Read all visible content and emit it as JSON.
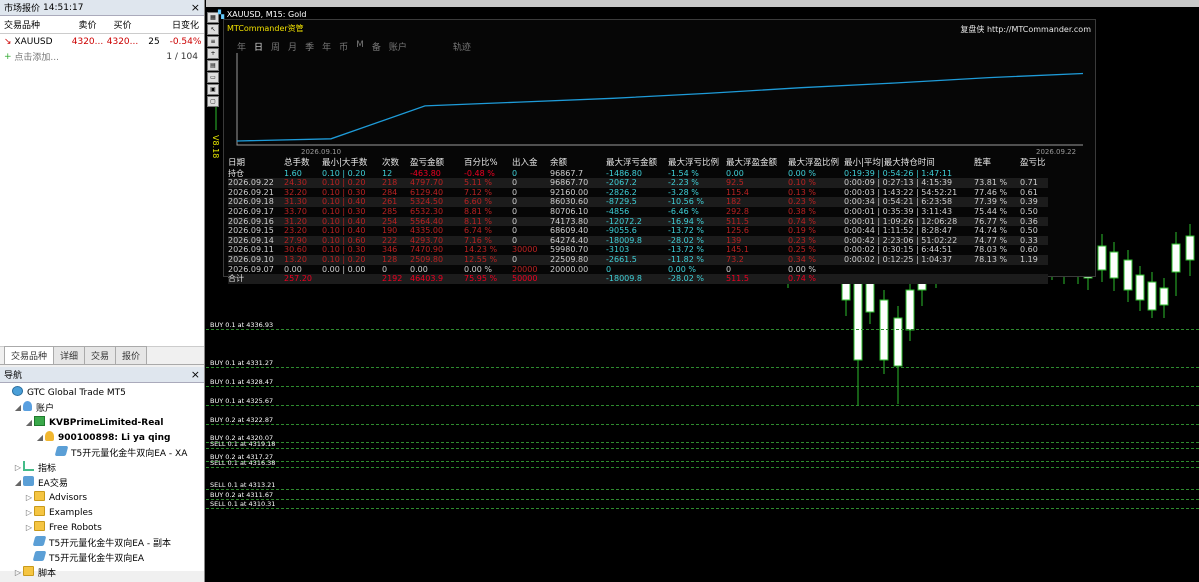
{
  "market_watch": {
    "title": "市场报价",
    "time": "14:51:17",
    "columns": [
      "交易品种",
      "卖价",
      "买价",
      "",
      "日变化"
    ],
    "rows": [
      {
        "symbol": "XAUUSD",
        "bid": "4320...",
        "ask": "4320...",
        "spread": "25",
        "change": "-0.54%"
      }
    ],
    "add_label": "点击添加...",
    "count": "1 / 104",
    "tabs": [
      "交易品种",
      "详细",
      "交易",
      "报价"
    ]
  },
  "navigator": {
    "title": "导航",
    "items": [
      {
        "label": "GTC Global Trade MT5",
        "level": 0,
        "toggle": "",
        "icon": "globe-icon"
      },
      {
        "label": "账户",
        "level": 1,
        "toggle": "◢",
        "icon": "accounts-icon"
      },
      {
        "label": "KVBPrimeLimited-Real",
        "level": 2,
        "toggle": "◢",
        "icon": "server-icon",
        "bold": true
      },
      {
        "label": "900100898: Li ya qing",
        "level": 3,
        "toggle": "◢",
        "icon": "user-icon",
        "bold": true
      },
      {
        "label": "T5开元量化金牛双向EA - XA",
        "level": 4,
        "toggle": "",
        "icon": "ea-icon"
      },
      {
        "label": "指标",
        "level": 1,
        "toggle": "▷",
        "icon": "indicator-icon"
      },
      {
        "label": "EA交易",
        "level": 1,
        "toggle": "◢",
        "icon": "ea-folder-icon"
      },
      {
        "label": "Advisors",
        "level": 2,
        "toggle": "▷",
        "icon": "folder-icon"
      },
      {
        "label": "Examples",
        "level": 2,
        "toggle": "▷",
        "icon": "folder-icon"
      },
      {
        "label": "Free Robots",
        "level": 2,
        "toggle": "▷",
        "icon": "folder-icon"
      },
      {
        "label": "T5开元量化金牛双向EA - 副本",
        "level": 2,
        "toggle": "",
        "icon": "ea-icon"
      },
      {
        "label": "T5开元量化金牛双向EA",
        "level": 2,
        "toggle": "",
        "icon": "ea-icon"
      },
      {
        "label": "脚本",
        "level": 1,
        "toggle": "▷",
        "icon": "script-icon"
      }
    ]
  },
  "chart": {
    "title": "XAUUSD, M15:  Gold",
    "version_label": "V8.18",
    "mtc_title": "MTCommander资管",
    "mtc_site": "复盘侠 http://MTCommander.com",
    "mtc_tabs": [
      "年",
      "日",
      "周",
      "月",
      "季",
      "年",
      "币",
      "M",
      "备",
      "账户",
      "",
      "轨迹"
    ],
    "mtc_tab_selected": 1,
    "equity_start_label": "2026.09.10",
    "equity_end_label": "2026.09.22",
    "equity_curve": [
      20000,
      22509.8,
      59980.7,
      64274.4,
      68609.4,
      74173.8,
      80706.1,
      86030.6,
      92160.0,
      96867.7
    ]
  },
  "stats": {
    "headers": [
      "日期",
      "总手数",
      "最小|大手数",
      "次数",
      "盈亏金额",
      "百分比%",
      "出入金",
      "余额",
      "最大浮亏金额",
      "最大浮亏比例",
      "最大浮盈金额",
      "最大浮盈比例",
      "最小|平均|最大持仓时间",
      "",
      "胜率",
      "盈亏比"
    ],
    "holding": [
      "持仓",
      "1.60",
      "0.10 | 0.20",
      "12",
      "-463.80",
      "-0.48 %",
      "0",
      "96867.7",
      "-1486.80",
      "-1.54 %",
      "0.00",
      "0.00 %",
      "0:19:39 | 0:54:26 | 1:47:11",
      "",
      "",
      ""
    ],
    "rows": [
      [
        "2026.09.22",
        "24.30",
        "0.10 | 0.20",
        "218",
        "4797.70",
        "5.11 %",
        "0",
        "96867.70",
        "-2067.2",
        "-2.23 %",
        "92.5",
        "0.10 %",
        "0:00:09 | 0:27:13 | 4:15:39",
        "",
        "73.81 %",
        "0.71"
      ],
      [
        "2026.09.21",
        "32.20",
        "0.10 | 0.30",
        "284",
        "6129.40",
        "7.12 %",
        "0",
        "92160.00",
        "-2826.2",
        "-3.28 %",
        "115.4",
        "0.13 %",
        "0:00:03 | 1:43:22 | 54:52:21",
        "",
        "77.46 %",
        "0.61"
      ],
      [
        "2026.09.18",
        "31.30",
        "0.10 | 0.40",
        "261",
        "5324.50",
        "6.60 %",
        "0",
        "86030.60",
        "-8729.5",
        "-10.56 %",
        "182",
        "0.23 %",
        "0:00:34 | 0:54:21 | 6:23:58",
        "",
        "77.39 %",
        "0.39"
      ],
      [
        "2026.09.17",
        "33.70",
        "0.10 | 0.30",
        "285",
        "6532.30",
        "8.81 %",
        "0",
        "80706.10",
        "-4856",
        "-6.46 %",
        "292.8",
        "0.38 %",
        "0:00:01 | 0:35:39 | 3:11:43",
        "",
        "75.44 %",
        "0.50"
      ],
      [
        "2026.09.16",
        "31.20",
        "0.10 | 0.40",
        "254",
        "5564.40",
        "8.11 %",
        "0",
        "74173.80",
        "-12072.2",
        "-16.94 %",
        "511.5",
        "0.74 %",
        "0:00:01 | 1:09:26 | 12:06:28",
        "",
        "76.77 %",
        "0.36"
      ],
      [
        "2026.09.15",
        "23.20",
        "0.10 | 0.40",
        "190",
        "4335.00",
        "6.74 %",
        "0",
        "68609.40",
        "-9055.6",
        "-13.72 %",
        "125.6",
        "0.19 %",
        "0:00:44 | 1:11:52 | 8:28:47",
        "",
        "74.74 %",
        "0.50"
      ],
      [
        "2026.09.14",
        "27.90",
        "0.10 | 0.60",
        "222",
        "4293.70",
        "7.16 %",
        "0",
        "64274.40",
        "-18009.8",
        "-28.02 %",
        "139",
        "0.23 %",
        "0:00:42 | 2:23:06 | 51:02:22",
        "",
        "74.77 %",
        "0.33"
      ],
      [
        "2026.09.11",
        "30.60",
        "0.10 | 0.30",
        "346",
        "7470.90",
        "14.23 %",
        "30000",
        "59980.70",
        "-3103",
        "-13.72 %",
        "145.1",
        "0.25 %",
        "0:00:02 | 0:30:15 | 6:44:51",
        "",
        "78.03 %",
        "0.60"
      ],
      [
        "2026.09.10",
        "13.20",
        "0.10 | 0.20",
        "128",
        "2509.80",
        "12.55 %",
        "0",
        "22509.80",
        "-2661.5",
        "-11.82 %",
        "73.2",
        "0.34 %",
        "0:00:02 | 0:12:25 | 1:04:37",
        "",
        "78.13 %",
        "1.19"
      ],
      [
        "2026.09.07",
        "0.00",
        "0.00 | 0.00",
        "0",
        "0.00",
        "0.00 %",
        "20000",
        "20000.00",
        "0",
        "0.00 %",
        "0",
        "0.00 %",
        "",
        "",
        "",
        ""
      ]
    ],
    "total": [
      "合计",
      "257.20",
      "",
      "2192",
      "46403.9",
      "75.95 %",
      "50000",
      "",
      "-18009.8",
      "-28.02 %",
      "511.5",
      "0.74 %",
      "",
      "",
      "",
      ""
    ]
  },
  "orders": [
    {
      "label": "BUY 0.1 at 4336.93",
      "price": 4336.93
    },
    {
      "label": "BUY 0.1 at 4331.27",
      "price": 4331.27
    },
    {
      "label": "BUY 0.1 at 4328.47",
      "price": 4328.47
    },
    {
      "label": "BUY 0.1 at 4325.67",
      "price": 4325.67
    },
    {
      "label": "BUY 0.2 at 4322.87",
      "price": 4322.87
    },
    {
      "label": "BUY 0.2 at 4320.07",
      "price": 4320.07
    },
    {
      "label": "SELL 0.1 at 4319.18",
      "price": 4319.18
    },
    {
      "label": "BUY 0.2 at 4317.27",
      "price": 4317.27
    },
    {
      "label": "SELL 0.1 at 4316.38",
      "price": 4316.38
    },
    {
      "label": "SELL 0.1 at 4313.21",
      "price": 4313.21
    },
    {
      "label": "BUY 0.2 at 4311.67",
      "price": 4311.67
    },
    {
      "label": "SELL 0.1 at 4310.31",
      "price": 4310.31
    }
  ]
}
